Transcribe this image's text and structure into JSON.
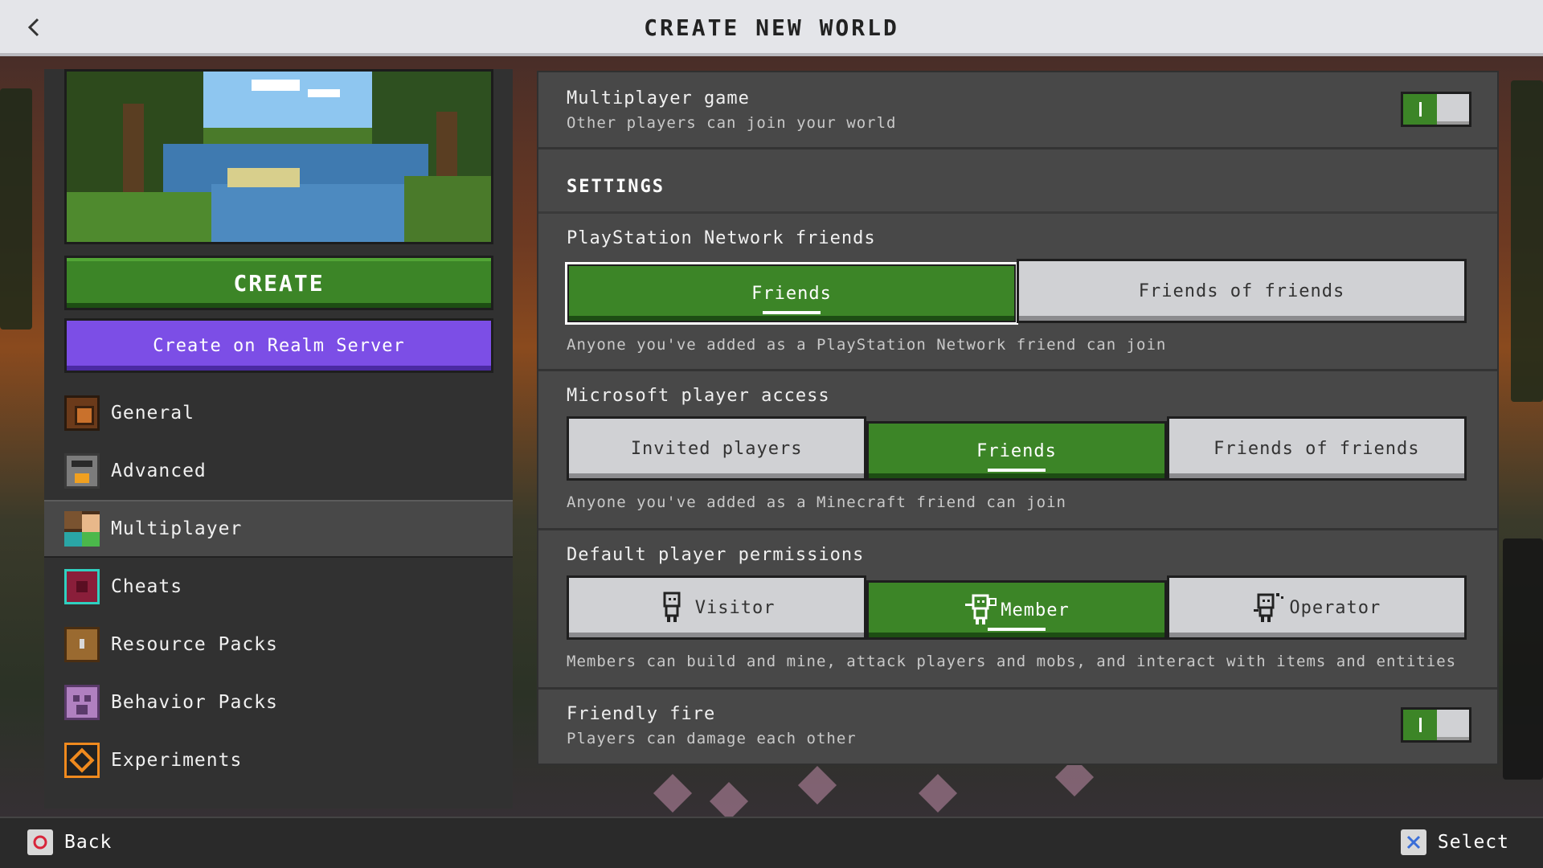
{
  "header": {
    "title": "CREATE NEW WORLD",
    "back_icon": "chevron-left-icon"
  },
  "left": {
    "create_label": "CREATE",
    "realm_label": "Create on Realm Server",
    "nav": [
      {
        "label": "General",
        "icon": "gear-icon"
      },
      {
        "label": "Advanced",
        "icon": "furnace-icon"
      },
      {
        "label": "Multiplayer",
        "icon": "players-icon",
        "active": true
      },
      {
        "label": "Cheats",
        "icon": "command-block-icon"
      },
      {
        "label": "Resource Packs",
        "icon": "chest-icon"
      },
      {
        "label": "Behavior Packs",
        "icon": "creeper-icon"
      },
      {
        "label": "Experiments",
        "icon": "experiment-icon"
      }
    ]
  },
  "main": {
    "multiplayer": {
      "title": "Multiplayer game",
      "subtitle": "Other players can join your world",
      "enabled": true
    },
    "settings_header": "SETTINGS",
    "psn": {
      "title": "PlayStation Network friends",
      "options": [
        "Friends",
        "Friends of friends"
      ],
      "selected": "Friends",
      "description": "Anyone you've added as a PlayStation Network friend can join"
    },
    "microsoft": {
      "title": "Microsoft player access",
      "options": [
        "Invited players",
        "Friends",
        "Friends of friends"
      ],
      "selected": "Friends",
      "description": "Anyone you've added as a Minecraft friend can join"
    },
    "permissions": {
      "title": "Default player permissions",
      "options": [
        "Visitor",
        "Member",
        "Operator"
      ],
      "selected": "Member",
      "description": "Members can build and mine, attack players and mobs, and interact with items and entities"
    },
    "friendly_fire": {
      "title": "Friendly fire",
      "subtitle": "Players can damage each other",
      "enabled": true
    }
  },
  "footer": {
    "back_label": "Back",
    "select_label": "Select"
  },
  "colors": {
    "accent_green": "#3c8527",
    "realm_purple": "#7c4ee6",
    "panel": "#484848"
  }
}
